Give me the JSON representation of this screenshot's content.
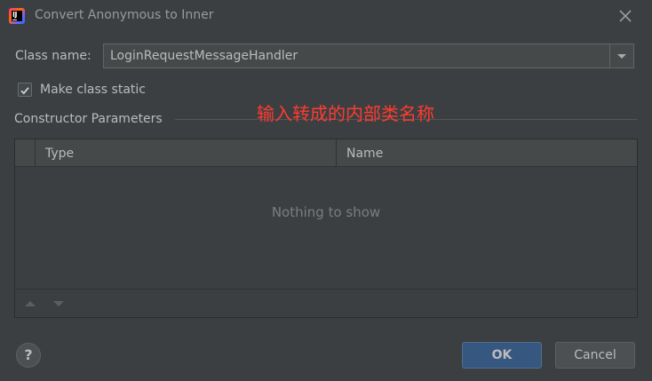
{
  "window": {
    "title": "Convert Anonymous to Inner",
    "app_icon": "intellij-idea-icon",
    "app_icon_letters": "IJ",
    "close_icon": "close-icon"
  },
  "form": {
    "class_name_label": "Class name:",
    "class_name_value": "LoginRequestMessageHandler",
    "make_static_label": "Make class static",
    "make_static_checked": true
  },
  "annotation": {
    "text": "输入转成的内部类名称",
    "color": "#ff3b30"
  },
  "constructor_parameters": {
    "title": "Constructor Parameters",
    "columns": [
      "Type",
      "Name"
    ],
    "rows": [],
    "empty_text": "Nothing to show",
    "toolbar": [
      "move-up-icon",
      "move-down-icon"
    ]
  },
  "footer": {
    "help_label": "?",
    "ok_label": "OK",
    "cancel_label": "Cancel"
  },
  "colors": {
    "background": "#3c3f41",
    "accent_button": "#365880"
  }
}
